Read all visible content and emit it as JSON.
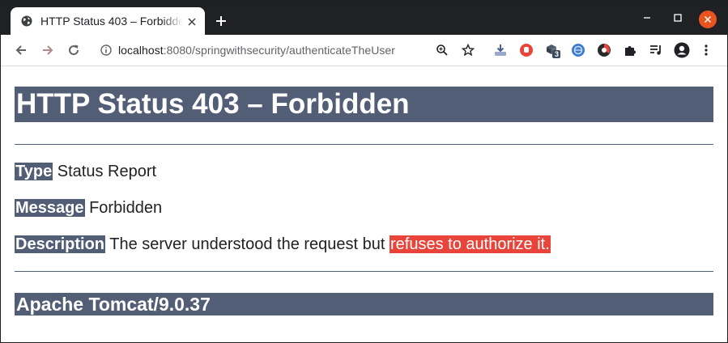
{
  "browser": {
    "tab_title": "HTTP Status 403 – Forbidden",
    "url_host": "localhost",
    "url_rest": ":8080/springwithsecurity/authenticateTheUser",
    "extension_badge": "3"
  },
  "page": {
    "heading": "HTTP Status 403 – Forbidden",
    "type_label": "Type",
    "type_value": "Status Report",
    "message_label": "Message",
    "message_value": "Forbidden",
    "description_label": "Description",
    "description_value": "The server understood the request but",
    "description_highlight": "refuses to authorize it.",
    "footer": "Apache Tomcat/9.0.37"
  },
  "colors": {
    "heading_bg": "#525d76",
    "highlight_bg": "#e8443a",
    "close_button": "#e95420"
  },
  "icons": [
    "globe-icon",
    "close-icon",
    "plus-icon",
    "minimize-icon",
    "maximize-icon",
    "back-icon",
    "forward-icon",
    "reload-icon",
    "info-icon",
    "zoom-icon",
    "star-icon",
    "download-extension-icon",
    "shield-extension-icon",
    "cube-extension-icon",
    "globe-extension-icon",
    "circle-extension-icon",
    "puzzle-icon",
    "media-icon",
    "profile-icon",
    "menu-icon"
  ]
}
